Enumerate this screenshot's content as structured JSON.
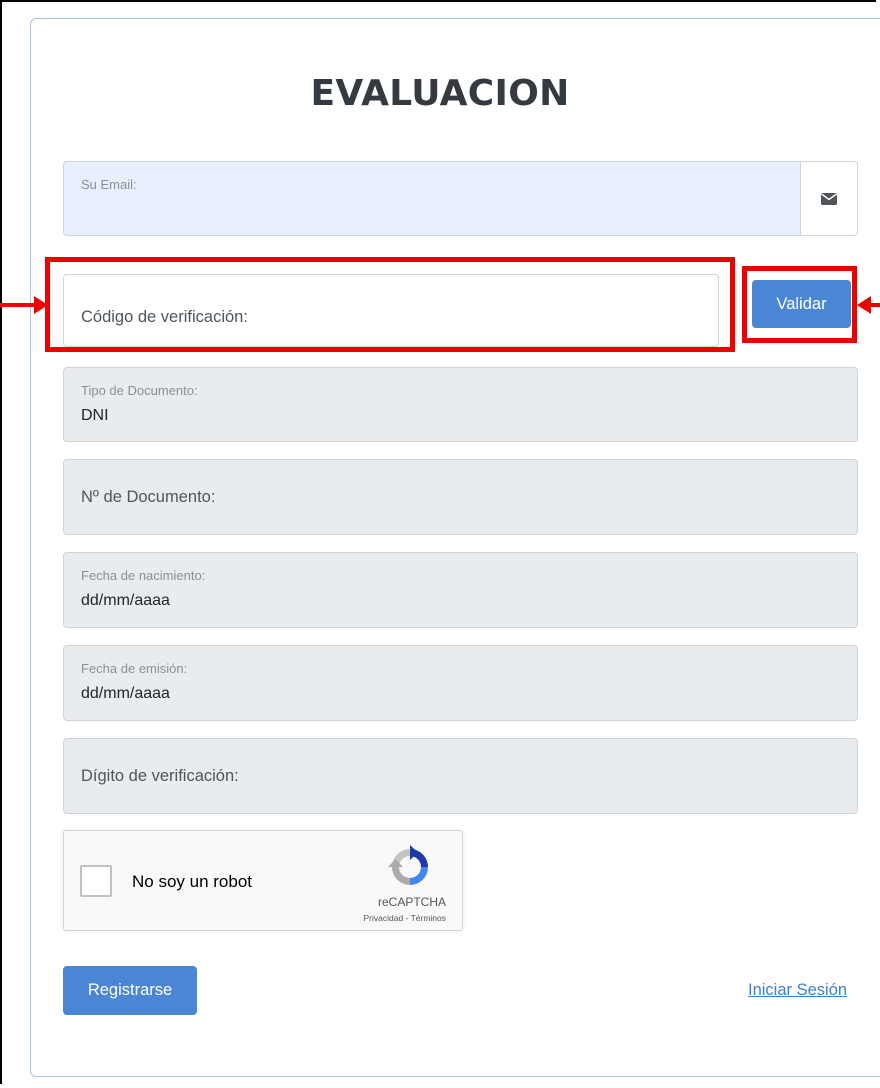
{
  "form": {
    "title": "EVALUACION",
    "email": {
      "label": "Su Email:",
      "icon": "envelope-icon"
    },
    "verification_code": {
      "placeholder": "Código de verificación:"
    },
    "validate_button": "Validar",
    "document_type": {
      "label": "Tipo de Documento:",
      "value": "DNI"
    },
    "document_number": {
      "placeholder": "Nº de Documento:"
    },
    "birth_date": {
      "label": "Fecha de nacimiento:",
      "value": "dd/mm/aaaa"
    },
    "issue_date": {
      "label": "Fecha de emisión:",
      "value": "dd/mm/aaaa"
    },
    "check_digit": {
      "placeholder": "Dígito de verificación:"
    },
    "recaptcha": {
      "label": "No soy un robot",
      "brand": "reCAPTCHA",
      "terms": "Privacidad - Términos"
    },
    "register_button": "Registrarse",
    "login_link": "Iniciar Sesión"
  },
  "colors": {
    "primary_button": "#4a86d4",
    "annotation_red": "#ee0000",
    "disabled_field": "#e9ecef",
    "autofill_field": "#e8f0fe"
  }
}
